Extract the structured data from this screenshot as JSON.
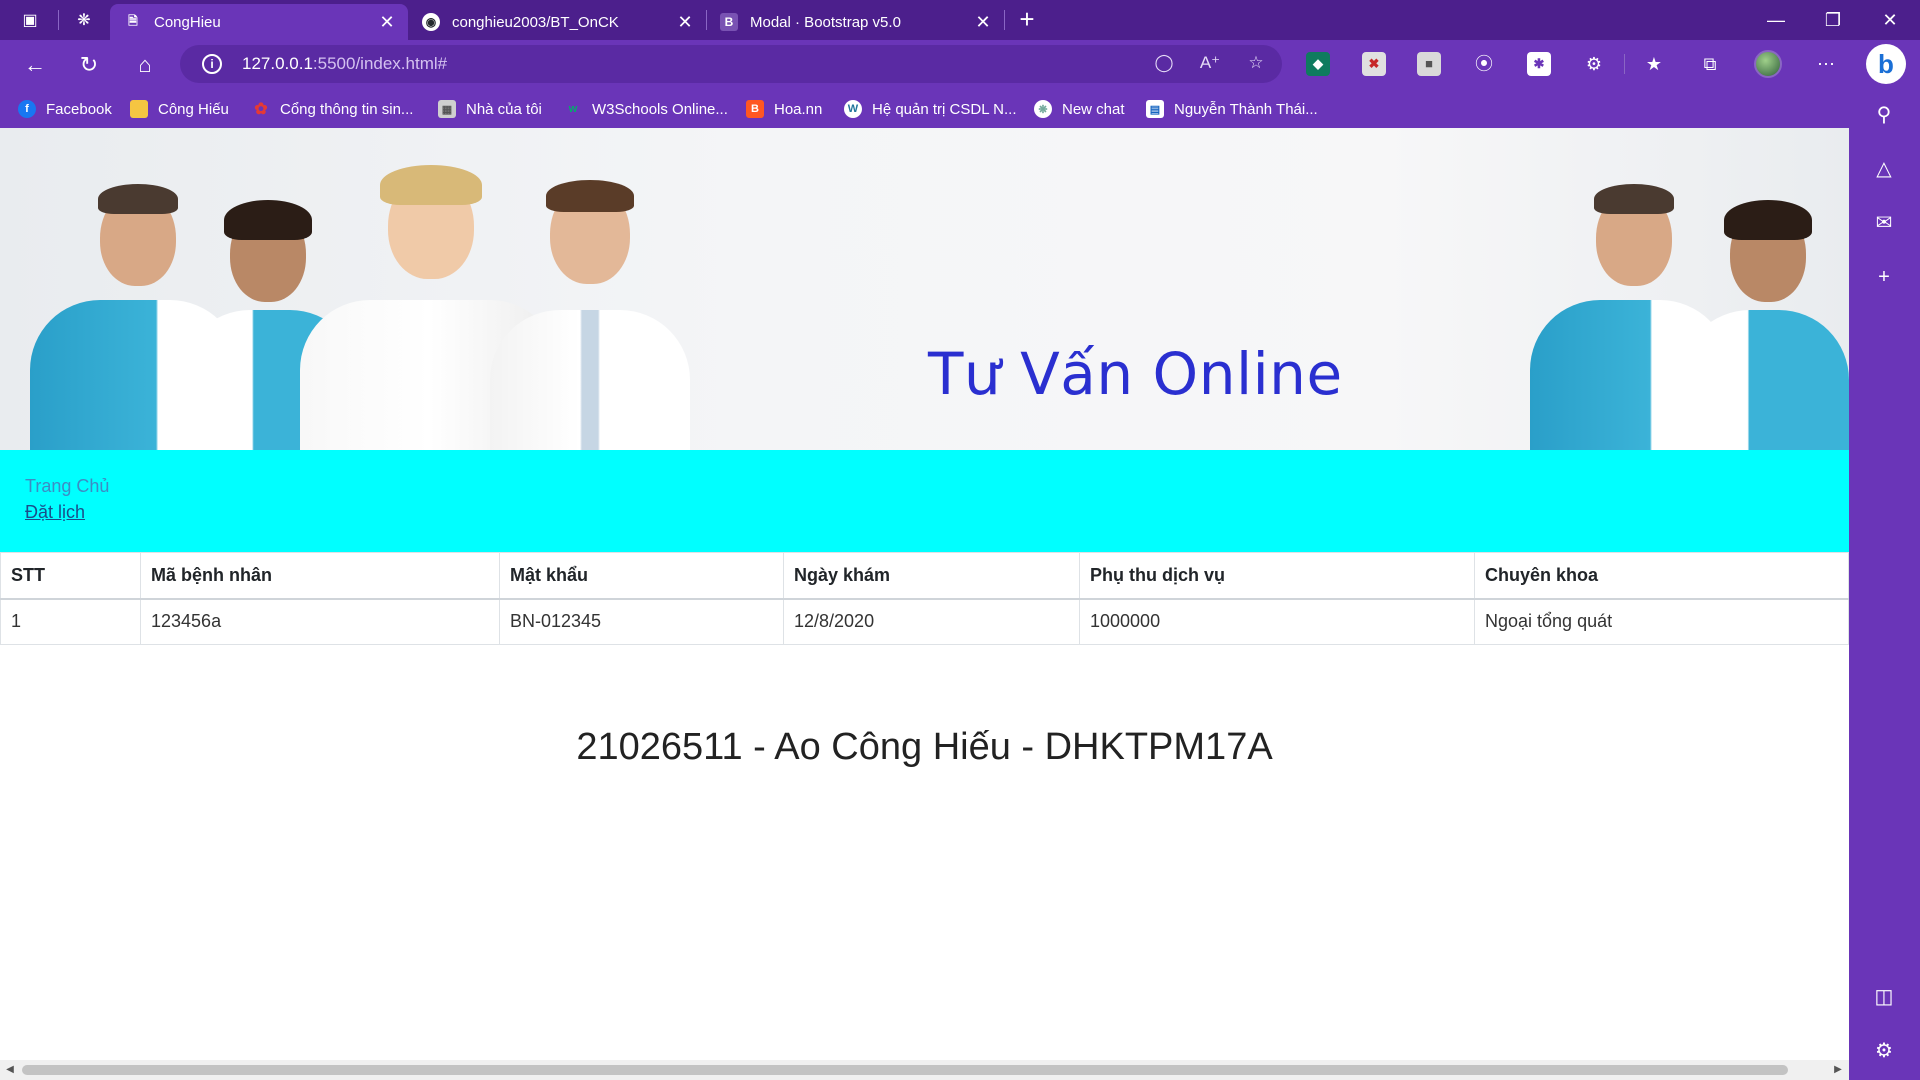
{
  "browser": {
    "tabs": [
      {
        "label": "CongHieu",
        "active": true,
        "icon": "page-icon"
      },
      {
        "label": "conghieu2003/BT_OnCK",
        "active": false,
        "icon": "github-icon"
      },
      {
        "label": "Modal · Bootstrap v5.0",
        "active": false,
        "icon": "bootstrap-icon"
      }
    ],
    "address": {
      "host": "127.0.0.1",
      "rest": ":5500/index.html#"
    },
    "bookmarks": [
      {
        "label": "Facebook",
        "icon": "facebook-icon",
        "color": "#1877f2"
      },
      {
        "label": "Công Hiếu",
        "icon": "folder-icon",
        "color": "#f5c542"
      },
      {
        "label": "Cổng thông tin sin...",
        "icon": "portal-icon",
        "color": "#d32f2f"
      },
      {
        "label": "Nhà của tôi",
        "icon": "home-doc-icon",
        "color": "#9e9e9e"
      },
      {
        "label": "W3Schools Online...",
        "icon": "w3schools-icon",
        "color": "#04aa6d"
      },
      {
        "label": "Hoa.nn",
        "icon": "blogger-icon",
        "color": "#ff5722"
      },
      {
        "label": "Hệ quản trị CSDL N...",
        "icon": "wordpress-icon",
        "color": "#21759b"
      },
      {
        "label": "New chat",
        "icon": "chatgpt-icon",
        "color": "#74aa9c"
      },
      {
        "label": "Nguyễn Thành Thái...",
        "icon": "bookmark-icon",
        "color": "#1565c0"
      }
    ]
  },
  "banner": {
    "title": "Tư Vấn Online"
  },
  "nav": {
    "home": "Trang Chủ",
    "booking": "Đặt lịch"
  },
  "table": {
    "headers": [
      "STT",
      "Mã bệnh nhân",
      "Mật khẩu",
      "Ngày khám",
      "Phụ thu dịch vụ",
      "Chuyên khoa"
    ],
    "rows": [
      [
        "1",
        "123456a",
        "BN-012345",
        "12/8/2020",
        "1000000",
        "Ngoại tổng quát"
      ]
    ]
  },
  "footer": {
    "text": "21026511 - Ao Công Hiếu - DHKTPM17A"
  },
  "colors": {
    "browser_accent": "#6a35b8",
    "nav_background": "#00ffff",
    "banner_title": "#2a2fd0"
  }
}
